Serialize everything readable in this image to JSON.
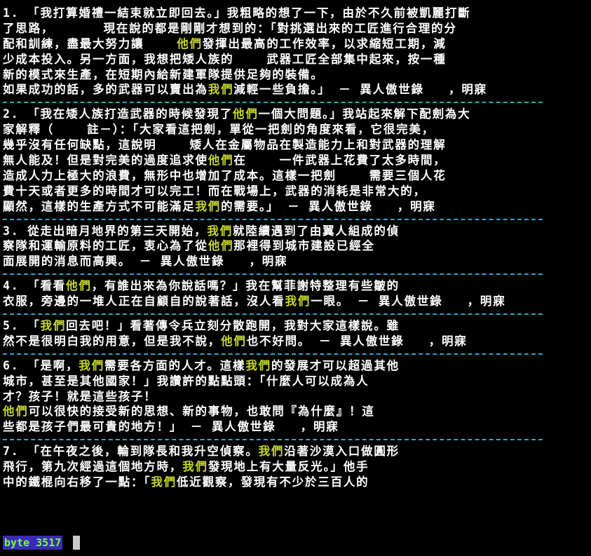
{
  "entries": [
    {
      "lines": [
        [
          {
            "t": "1. 「我打算婚禮一結束就立即回去。」我粗略的想了一下，由於不久前被凱麗打斷"
          }
        ],
        [
          {
            "t": "了思路，      現在說的都是剛剛才想到的：「對挑選出來的工匠進行合理的分"
          }
        ],
        [
          {
            "t": "配和訓練，盡最大努力讓    "
          },
          {
            "t": "他們",
            "hl": true
          },
          {
            "t": "發揮出最高的工作效率，以求縮短工期，減"
          }
        ],
        [
          {
            "t": "少成本投入。另一方面，我想把矮人族的    武器工匠全部集中起來，按一種"
          }
        ],
        [
          {
            "t": "新的模式來生產，在短期內給新建軍隊提供足夠的裝備。"
          }
        ],
        [
          {
            "t": "如果成功的話，多的武器可以賣出為"
          },
          {
            "t": "我們",
            "hl": true
          },
          {
            "t": "減輕一些負擔。」 － 異人傲世錄   ，明寐"
          }
        ]
      ]
    },
    {
      "lines": [
        [
          {
            "t": "2. 「我在矮人族打造武器的時候發現了"
          },
          {
            "t": "他們",
            "hl": true
          },
          {
            "t": "一個大問題。」我站起來解下配劍為大"
          }
        ],
        [
          {
            "t": "家解釋（    註－）：「大家看這把劍，單從一把劍的角度來看，它很完美，"
          }
        ],
        [
          {
            "t": "幾乎沒有任何缺點，這說明    矮人在金屬物品在製造能力上和對武器的理解"
          }
        ],
        [
          {
            "t": "無人能及！但是對完美的過度追求使"
          },
          {
            "t": "他們",
            "hl": true
          },
          {
            "t": "在    一件武器上花費了太多時間，"
          }
        ],
        [
          {
            "t": "造成人力上極大的浪費，無形中也增加了成本。這樣一把劍    需要三個人花"
          }
        ],
        [
          {
            "t": "費十天或者更多的時間才可以完工！而在戰場上，武器的消耗是非常大的，"
          }
        ],
        [
          {
            "t": "顯然，這樣的生產方式不可能滿足"
          },
          {
            "t": "我們",
            "hl": true
          },
          {
            "t": "的需要。」 － 異人傲世錄   ，明寐"
          }
        ]
      ]
    },
    {
      "lines": [
        [
          {
            "t": "3. 從走出暗月地界的第三天開始，"
          },
          {
            "t": "我們",
            "hl": true
          },
          {
            "t": "就陸續遇到了由翼人組成的偵"
          }
        ],
        [
          {
            "t": "察隊和運輸原料的工匠，衷心為了從"
          },
          {
            "t": "他們",
            "hl": true
          },
          {
            "t": "那裡得到城市建設已經全"
          }
        ],
        [
          {
            "t": "面展開的消息而高興。 － 異人傲世錄   ，明寐"
          }
        ]
      ]
    },
    {
      "lines": [
        [
          {
            "t": "4. 「看看"
          },
          {
            "t": "他們",
            "hl": true
          },
          {
            "t": "，有誰出來為你說話嗎？」我在幫菲謝特整理有些皺的"
          }
        ],
        [
          {
            "t": "衣服，旁邊的一堆人正在自顧自的說著話，沒人看"
          },
          {
            "t": "我們",
            "hl": true
          },
          {
            "t": "一眼。 － 異人傲世錄   ，明寐"
          }
        ]
      ]
    },
    {
      "lines": [
        [
          {
            "t": "5. 「"
          },
          {
            "t": "我們",
            "hl": true
          },
          {
            "t": "回去吧！」看著傳令兵立刻分散跑開，我對大家這樣說。雖"
          }
        ],
        [
          {
            "t": "然不是很明白我的用意，但是我不說，"
          },
          {
            "t": "他們",
            "hl": true
          },
          {
            "t": "也不好問。 － 異人傲世錄   ，明寐"
          }
        ]
      ]
    },
    {
      "lines": [
        [
          {
            "t": "6. 「是啊，"
          },
          {
            "t": "我們",
            "hl": true
          },
          {
            "t": "需要各方面的人才。這樣"
          },
          {
            "t": "我們",
            "hl": true
          },
          {
            "t": "的發展才可以超過其他"
          }
        ],
        [
          {
            "t": "城市，甚至是其他國家！」我讚許的點點頭：「什麼人可以成為人"
          }
        ],
        [
          {
            "t": "才？孩子！就是這些孩子！"
          }
        ],
        [
          {
            "t": "他們",
            "hl": true
          },
          {
            "t": "可以很快的接受新的思想、新的事物，也敢問『為什麼』！這"
          }
        ],
        [
          {
            "t": "些都是孩子們最可貴的地方！」 － 異人傲世錄   ，明寐"
          }
        ]
      ]
    },
    {
      "lines": [
        [
          {
            "t": "7. 「在午夜之後，輪到隊長和我升空偵察。"
          },
          {
            "t": "我們",
            "hl": true
          },
          {
            "t": "沿著沙漠入口做圓形"
          }
        ],
        [
          {
            "t": "飛行，第九次經過這個地方時，"
          },
          {
            "t": "我們",
            "hl": true
          },
          {
            "t": "發現地上有大量反光。」他手"
          }
        ],
        [
          {
            "t": "中的鐵棍向右移了一點：「"
          },
          {
            "t": "我們",
            "hl": true
          },
          {
            "t": "低近觀察，發現有不少於三百人的"
          }
        ]
      ]
    }
  ],
  "status": {
    "label": "byte 3517"
  },
  "colors": {
    "highlight": "#c6d62b",
    "separator": "#2aa7c7",
    "status_fg": "#7cff3a",
    "status_bg": "#3a2bb5"
  }
}
